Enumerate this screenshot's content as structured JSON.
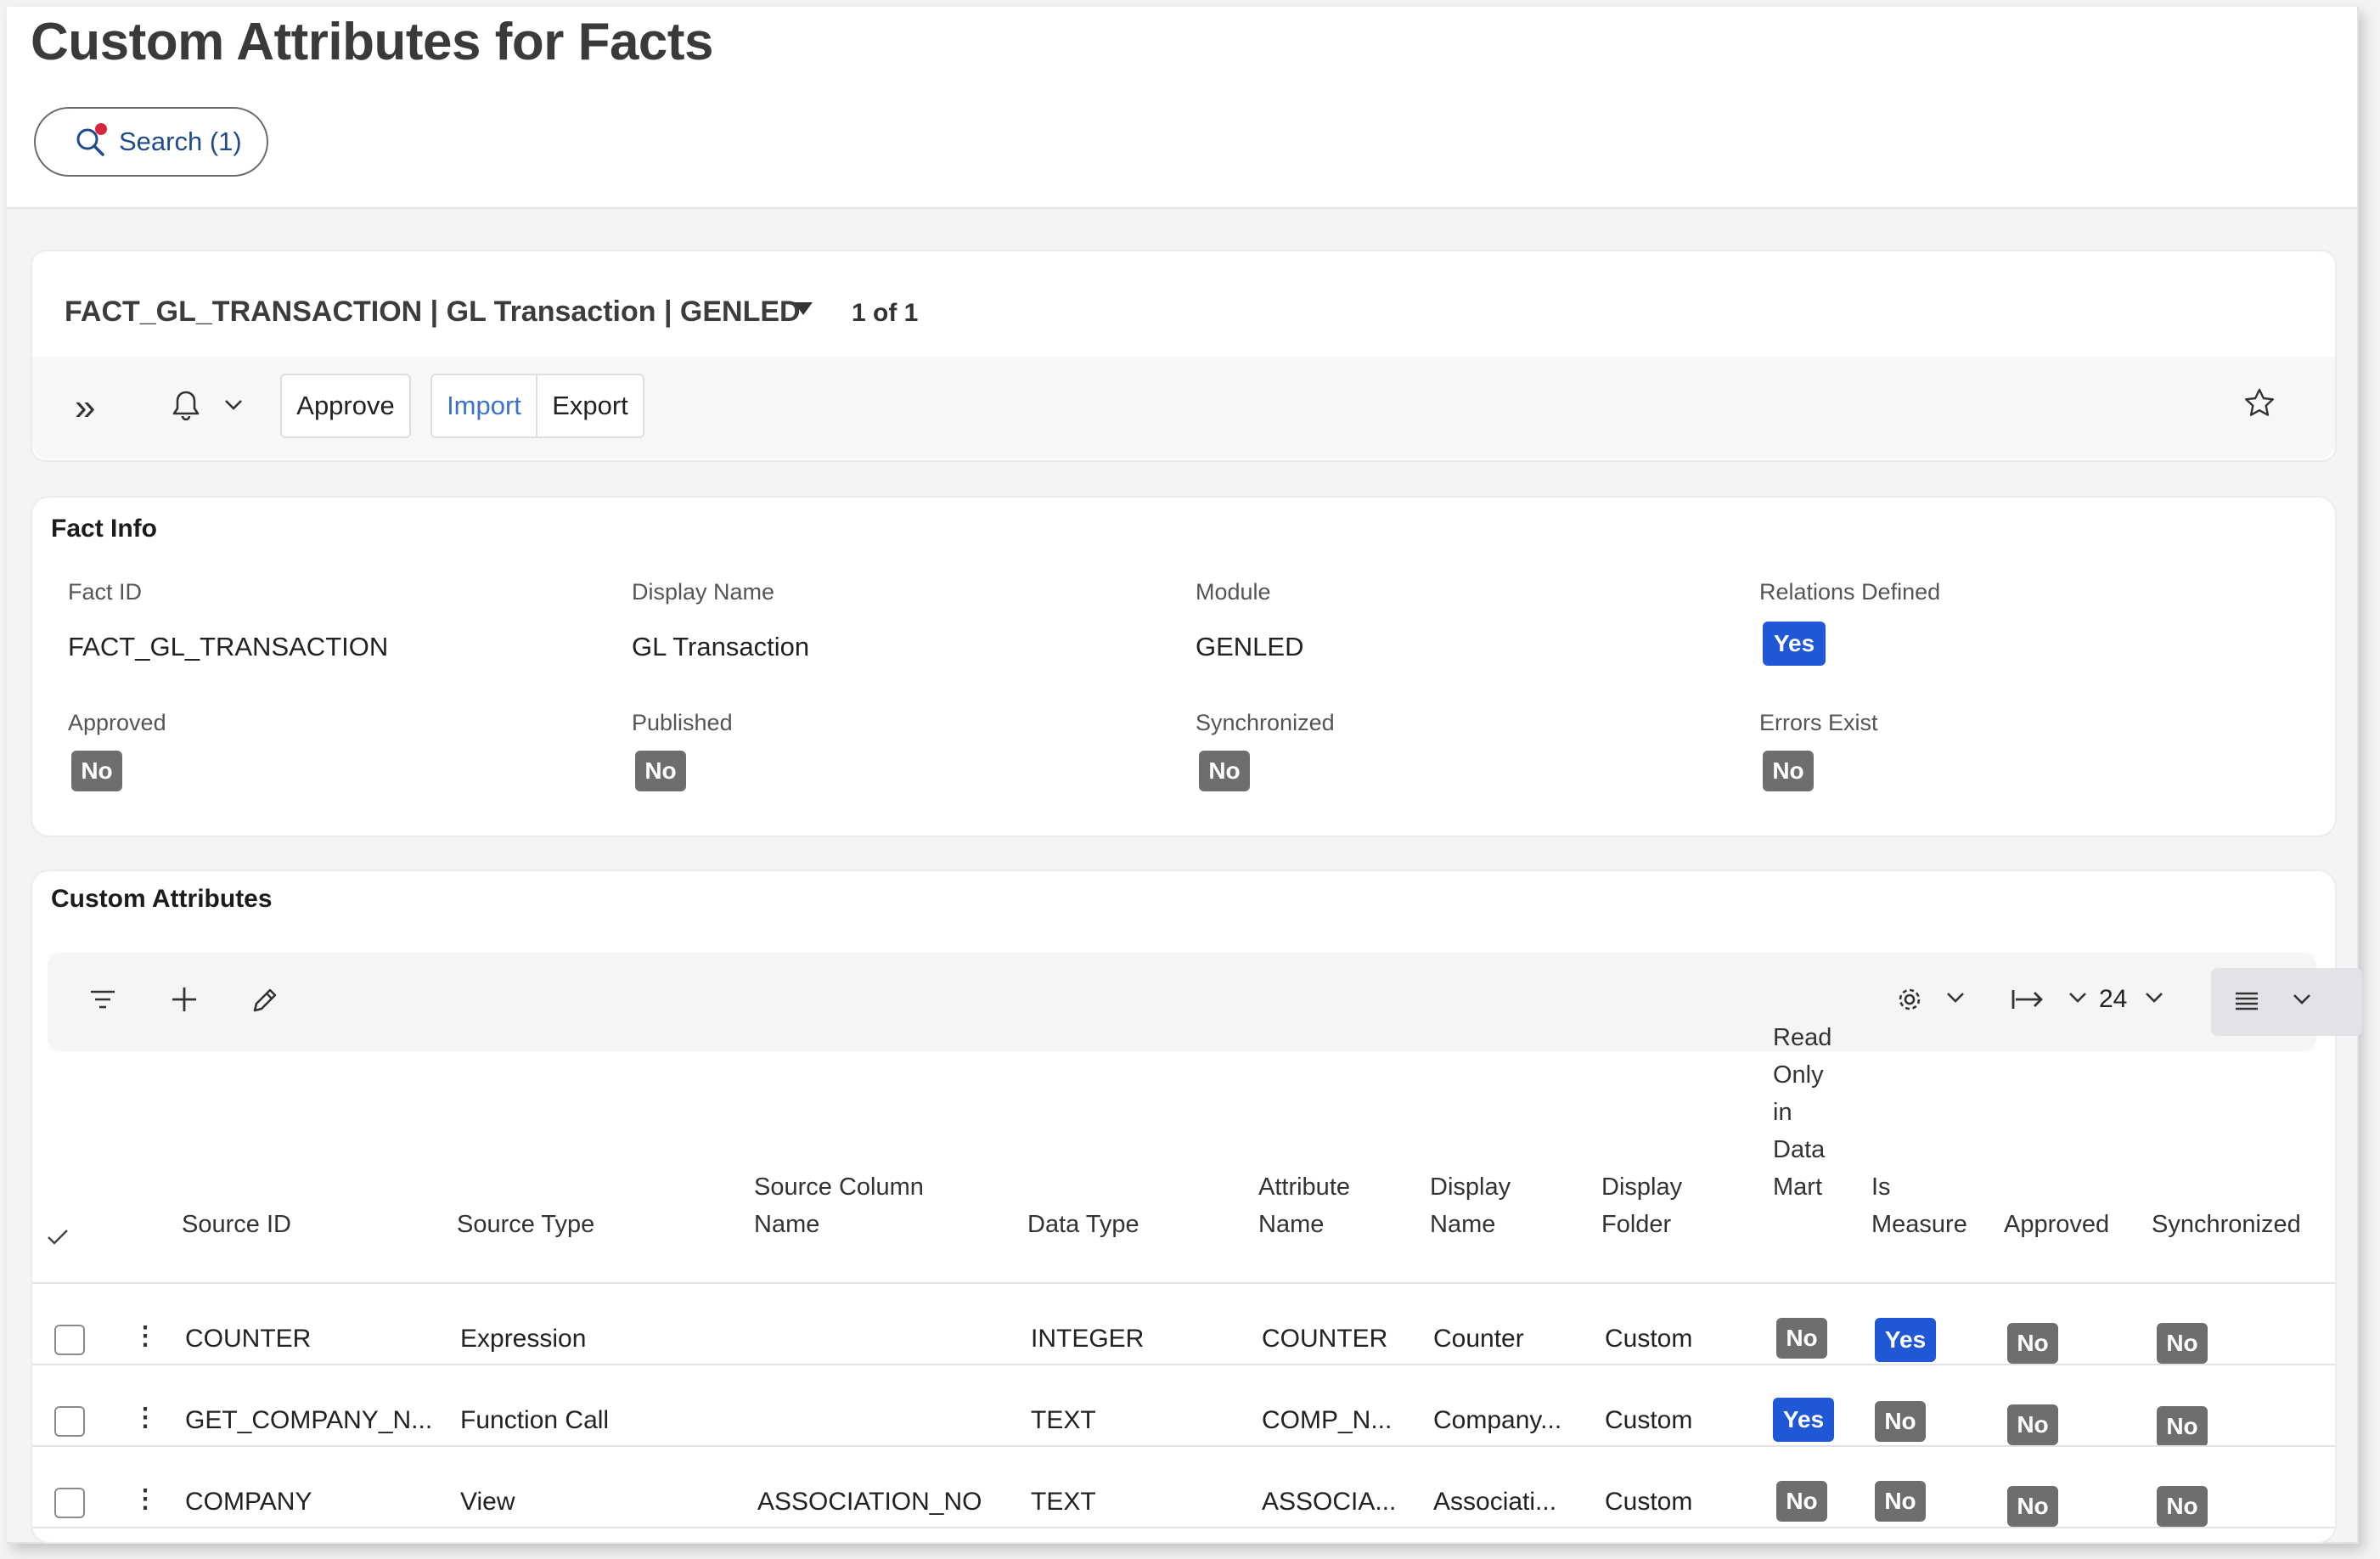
{
  "page": {
    "title": "Custom Attributes for Facts",
    "search_label": "Search (1)"
  },
  "record": {
    "title": "FACT_GL_TRANSACTION | GL Transaction | GENLED",
    "count": "1 of 1",
    "toolbar": {
      "approve": "Approve",
      "import": "Import",
      "export": "Export"
    }
  },
  "fact_info": {
    "title": "Fact Info",
    "fact_id_label": "Fact ID",
    "fact_id": "FACT_GL_TRANSACTION",
    "display_name_label": "Display Name",
    "display_name": "GL Transaction",
    "module_label": "Module",
    "module": "GENLED",
    "relations_label": "Relations Defined",
    "relations": "Yes",
    "approved_label": "Approved",
    "approved": "No",
    "published_label": "Published",
    "published": "No",
    "synchronized_label": "Synchronized",
    "synchronized": "No",
    "errors_label": "Errors Exist",
    "errors": "No"
  },
  "custom_attributes": {
    "title": "Custom Attributes",
    "rows_per_page": "24",
    "columns": {
      "source_id": "Source ID",
      "source_type": "Source Type",
      "source_column_1": "Source Column",
      "source_column_2": "Name",
      "data_type": "Data Type",
      "attr_name_1": "Attribute",
      "attr_name_2": "Name",
      "display_name_1": "Display",
      "display_name_2": "Name",
      "display_folder_1": "Display",
      "display_folder_2": "Folder",
      "read_only_1": "Read",
      "read_only_2": "Only",
      "read_only_3": "in",
      "read_only_4": "Data",
      "read_only_5": "Mart",
      "is_measure_1": "Is",
      "is_measure_2": "Measure",
      "approved": "Approved",
      "synchronized": "Synchronized"
    },
    "rows": [
      {
        "source_id": "COUNTER",
        "source_type": "Expression",
        "source_column": "",
        "data_type": "INTEGER",
        "attribute_name": "COUNTER",
        "display_name": "Counter",
        "display_folder": "Custom",
        "read_only": "No",
        "is_measure": "Yes",
        "approved": "No",
        "synchronized": "No"
      },
      {
        "source_id": "GET_COMPANY_N...",
        "source_type": "Function Call",
        "source_column": "",
        "data_type": "TEXT",
        "attribute_name": "COMP_N...",
        "display_name": "Company...",
        "display_folder": "Custom",
        "read_only": "Yes",
        "is_measure": "No",
        "approved": "No",
        "synchronized": "No"
      },
      {
        "source_id": "COMPANY",
        "source_type": "View",
        "source_column": "ASSOCIATION_NO",
        "data_type": "TEXT",
        "attribute_name": "ASSOCIA...",
        "display_name": "Associati...",
        "display_folder": "Custom",
        "read_only": "No",
        "is_measure": "No",
        "approved": "No",
        "synchronized": "No"
      }
    ]
  },
  "colors": {
    "badge_yes": "#1f57d6",
    "badge_no": "#6e6e6e",
    "link": "#3b73c9"
  }
}
